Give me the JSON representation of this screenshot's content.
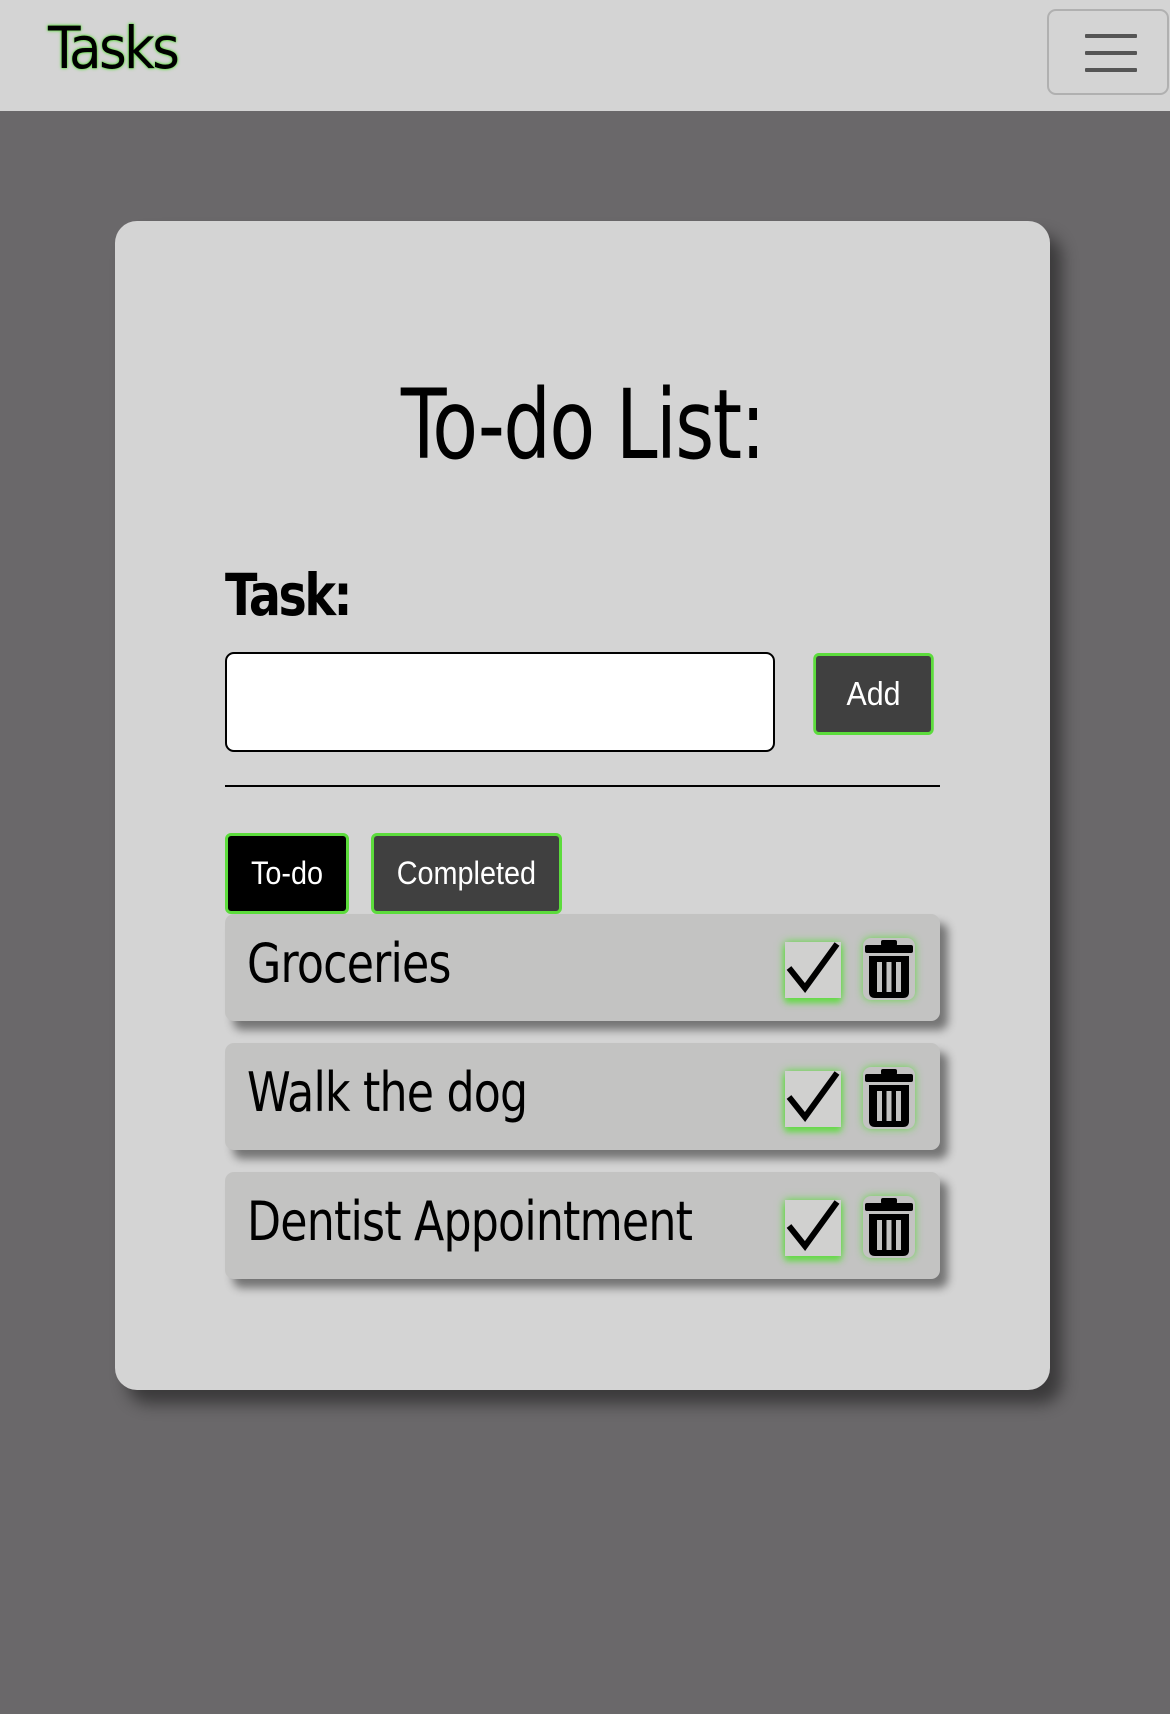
{
  "navbar": {
    "brand": "Tasks",
    "menu_icon": "hamburger-menu-icon"
  },
  "card": {
    "title": "To-do List:",
    "task_label": "Task:",
    "task_input": {
      "value": "",
      "placeholder": ""
    },
    "add_label": "Add"
  },
  "tabs": [
    {
      "label": "To-do",
      "active": true
    },
    {
      "label": "Completed",
      "active": false
    }
  ],
  "tasks": [
    {
      "text": "Groceries"
    },
    {
      "text": "Walk the dog"
    },
    {
      "text": "Dentist Appointment"
    }
  ],
  "icons": {
    "complete": "checkmark-icon",
    "delete": "trash-icon"
  },
  "colors": {
    "accent": "#5cdc3c",
    "background": "#6a686a",
    "surface": "#d4d4d4",
    "task_surface": "#c3c3c2",
    "button_dark": "#404040",
    "tab_active": "#000000"
  }
}
